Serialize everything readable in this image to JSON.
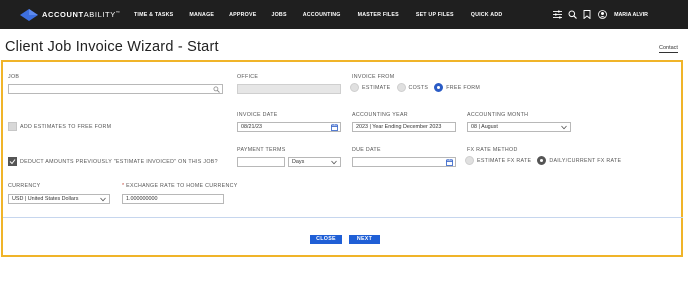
{
  "app": {
    "brand_bold": "ACCOUNT",
    "brand_light": "ABILITY",
    "trademark": "™"
  },
  "nav": {
    "items": [
      "TIME & TASKS",
      "MANAGE",
      "APPROVE",
      "JOBS",
      "ACCOUNTING",
      "MASTER FILES",
      "SET UP FILES",
      "QUICK ADD"
    ],
    "user_name": "MARIA ALVIR",
    "icons": [
      "sliders-icon",
      "search-icon",
      "bookmark-icon",
      "user-icon"
    ]
  },
  "page": {
    "title": "Client Job Invoice Wizard - Start",
    "contact_link": "Contact"
  },
  "form": {
    "job": {
      "label": "JOB",
      "value": ""
    },
    "office": {
      "label": "OFFICE",
      "value": ""
    },
    "invoice_from": {
      "label": "INVOICE FROM",
      "options": [
        "ESTIMATE",
        "COSTS",
        "FREE FORM"
      ],
      "selected": "FREE FORM"
    },
    "add_estimates": {
      "label": "ADD ESTIMATES TO FREE FORM",
      "checked": false
    },
    "invoice_date": {
      "label": "INVOICE DATE",
      "value": "08/21/23"
    },
    "accounting_year": {
      "label": "ACCOUNTING YEAR",
      "value": "2023 | Year Ending December 2023"
    },
    "accounting_month": {
      "label": "ACCOUNTING MONTH",
      "value": "08 | August"
    },
    "deduct_amounts": {
      "label": "DEDUCT AMOUNTS PREVIOUSLY \"ESTIMATE INVOICED\" ON THIS JOB?",
      "checked": true
    },
    "payment_terms": {
      "label": "PAYMENT TERMS",
      "value": "",
      "unit": "Days"
    },
    "due_date": {
      "label": "DUE DATE",
      "value": ""
    },
    "fx_rate_method": {
      "label": "FX RATE METHOD",
      "options": [
        "ESTIMATE FX RATE",
        "DAILY/CURRENT FX RATE"
      ],
      "selected": "DAILY/CURRENT FX RATE"
    },
    "currency": {
      "label": "CURRENCY",
      "value": "USD | United States Dollars"
    },
    "exchange_rate": {
      "required_mark": "*",
      "label": "EXCHANGE RATE TO HOME CURRENCY",
      "value": "1.000000000"
    }
  },
  "buttons": {
    "close": "CLOSE",
    "next": "NEXT"
  },
  "colors": {
    "nav_bg": "#1f1f1f",
    "accent_blue": "#1f5fd6",
    "highlight_border": "#f0b429"
  }
}
